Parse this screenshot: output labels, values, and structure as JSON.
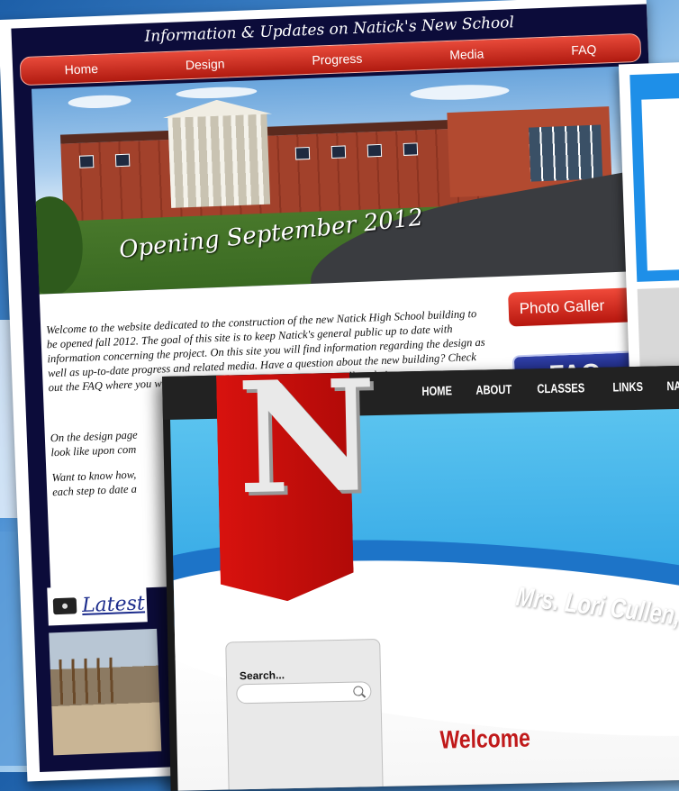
{
  "natick_site": {
    "header_title": "Information & Updates on Natick's New School",
    "nav": [
      "Home",
      "Design",
      "Progress",
      "Media",
      "FAQ"
    ],
    "hero_caption": "Opening September 2012",
    "welcome_text": "Welcome to the website dedicated to the construction of the new Natick High School building to be opened fall 2012. The goal of this site is to keep Natick's general public up to date with information concerning the project. On this site you will find information regarding the design as well as up-to-date progress and related media. Have a question about the new building? Check out the FAQ where you will find all of the common questions as well as their answers.",
    "design_para_line1": "On the design page",
    "design_para_line2": "look like upon com",
    "progress_para_line1": "Want to know how,",
    "progress_para_line2": "each step to date a",
    "photo_gallery_button": "Photo Galler",
    "faq_button": "FAQ",
    "latest_label": "Latest"
  },
  "cullen_site": {
    "nav": [
      "HOME",
      "ABOUT",
      "CLASSES",
      "LINKS",
      "NATI"
    ],
    "logo_letter": "N",
    "teacher_name": "Mrs. Lori Cullen,",
    "search_label": "Search...",
    "search_placeholder": "",
    "welcome_heading": "Welcome"
  },
  "colors": {
    "natick_red": "#c81e14",
    "natick_navy": "#0c0c3a",
    "cullen_red": "#c0191a",
    "cullen_sky": "#35a9e6"
  }
}
